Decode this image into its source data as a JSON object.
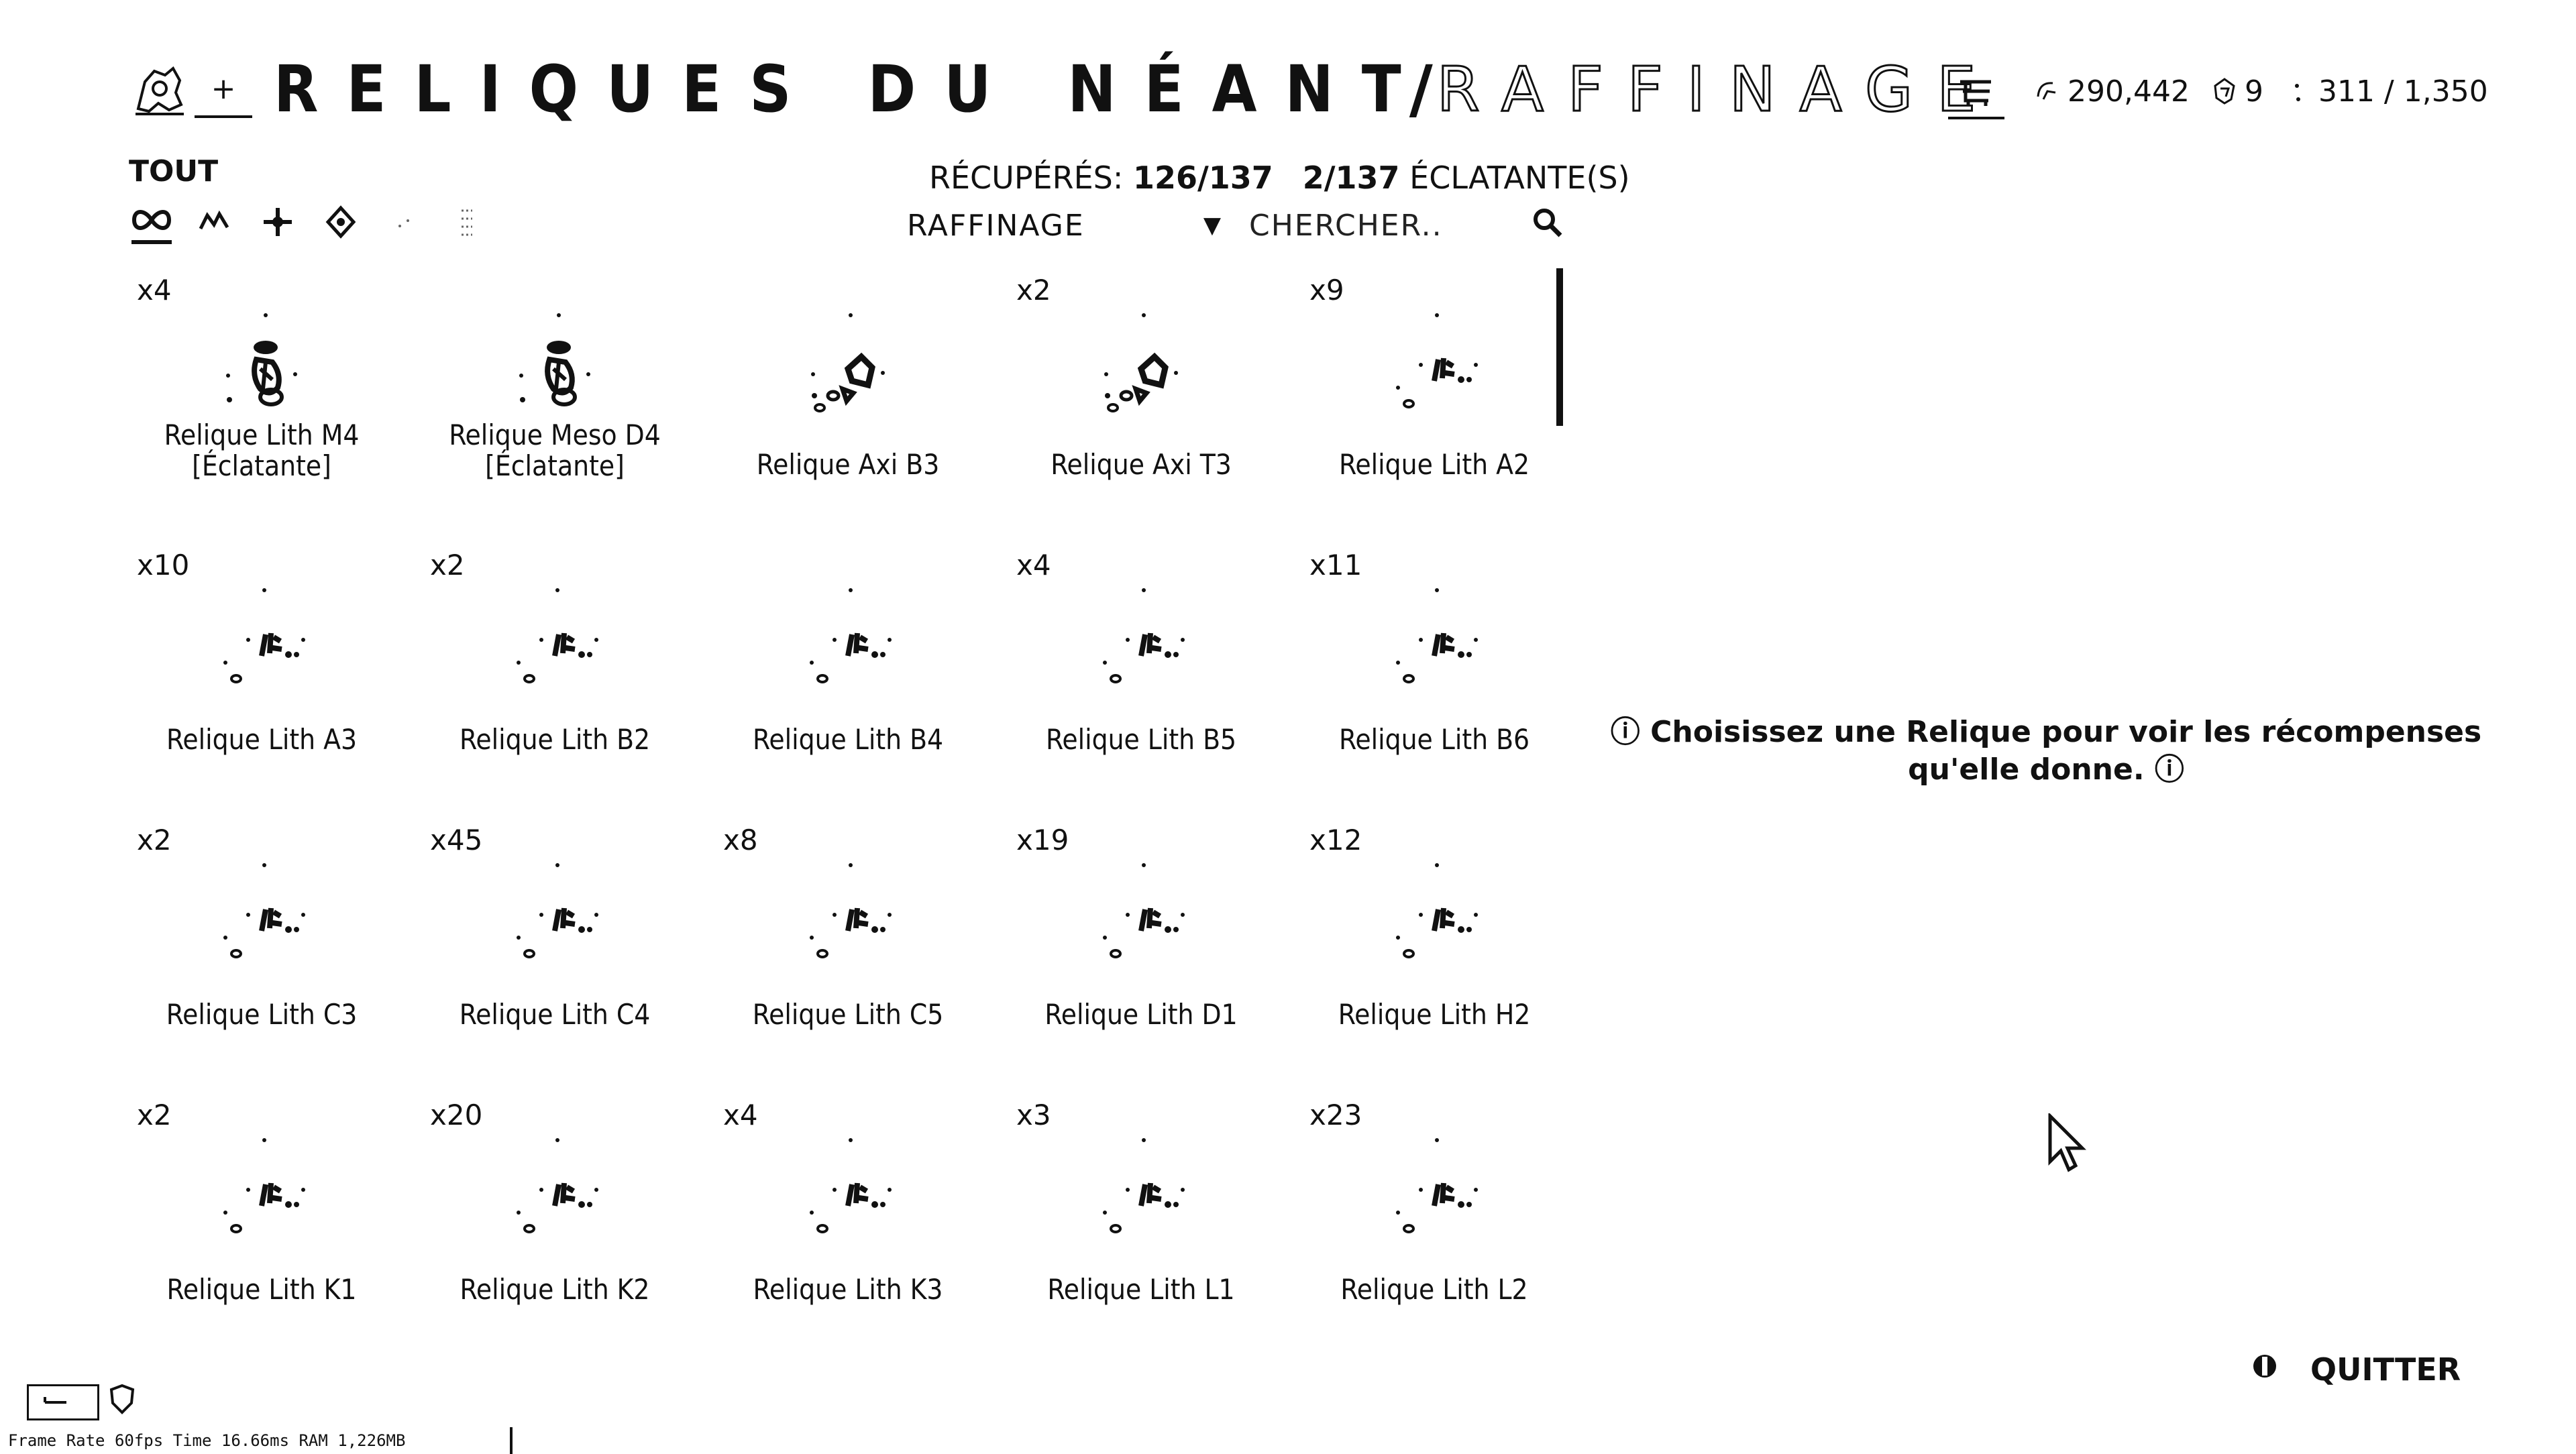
{
  "header": {
    "title_main": "RELIQUES DU NÉANT",
    "title_sep": "/",
    "title_sub": "RAFFINAGE",
    "plus_label": "+",
    "credits": "290,442",
    "platinum": "9",
    "slots": "311 / 1,350"
  },
  "filters": {
    "label": "TOUT",
    "icons": [
      "all-icon",
      "lith-icon",
      "meso-icon",
      "neo-icon",
      "axi-icon",
      "requiem-icon"
    ]
  },
  "stats": {
    "collected_label": "RÉCUPÉRÉS:",
    "collected_value": "126/137",
    "radiant_value": "2/137",
    "radiant_label": "ÉCLATANTE(S)"
  },
  "sort": {
    "value": "RAFFINAGE",
    "arrow": "▼"
  },
  "search": {
    "placeholder": "CHERCHER..",
    "icon": "search-icon"
  },
  "relics": [
    {
      "count": "x4",
      "name": "Relique Lith M4 [Éclatante]",
      "kind": "radiant"
    },
    {
      "count": "",
      "name": "Relique Meso D4 [Éclatante]",
      "kind": "radiant"
    },
    {
      "count": "",
      "name": "Relique Axi B3",
      "kind": "axi"
    },
    {
      "count": "x2",
      "name": "Relique Axi T3",
      "kind": "axi"
    },
    {
      "count": "x9",
      "name": "Relique Lith A2",
      "kind": "lith"
    },
    {
      "count": "x10",
      "name": "Relique Lith A3",
      "kind": "lith"
    },
    {
      "count": "x2",
      "name": "Relique Lith B2",
      "kind": "lith"
    },
    {
      "count": "",
      "name": "Relique Lith B4",
      "kind": "lith"
    },
    {
      "count": "x4",
      "name": "Relique Lith B5",
      "kind": "lith"
    },
    {
      "count": "x11",
      "name": "Relique Lith B6",
      "kind": "lith"
    },
    {
      "count": "x2",
      "name": "Relique Lith C3",
      "kind": "lith"
    },
    {
      "count": "x45",
      "name": "Relique Lith C4",
      "kind": "lith"
    },
    {
      "count": "x8",
      "name": "Relique Lith C5",
      "kind": "lith"
    },
    {
      "count": "x19",
      "name": "Relique Lith D1",
      "kind": "lith"
    },
    {
      "count": "x12",
      "name": "Relique Lith H2",
      "kind": "lith"
    },
    {
      "count": "x2",
      "name": "Relique Lith K1",
      "kind": "lith"
    },
    {
      "count": "x20",
      "name": "Relique Lith K2",
      "kind": "lith"
    },
    {
      "count": "x4",
      "name": "Relique Lith K3",
      "kind": "lith"
    },
    {
      "count": "x3",
      "name": "Relique Lith L1",
      "kind": "lith"
    },
    {
      "count": "x23",
      "name": "Relique Lith L2",
      "kind": "lith"
    }
  ],
  "info_text": "Choisissez une Relique pour voir les récompenses qu'elle donne.",
  "quit_label": "QUITTER",
  "debug": {
    "fps_text": "Frame Rate 60fps Time 16.66ms RAM 1,226MB"
  }
}
